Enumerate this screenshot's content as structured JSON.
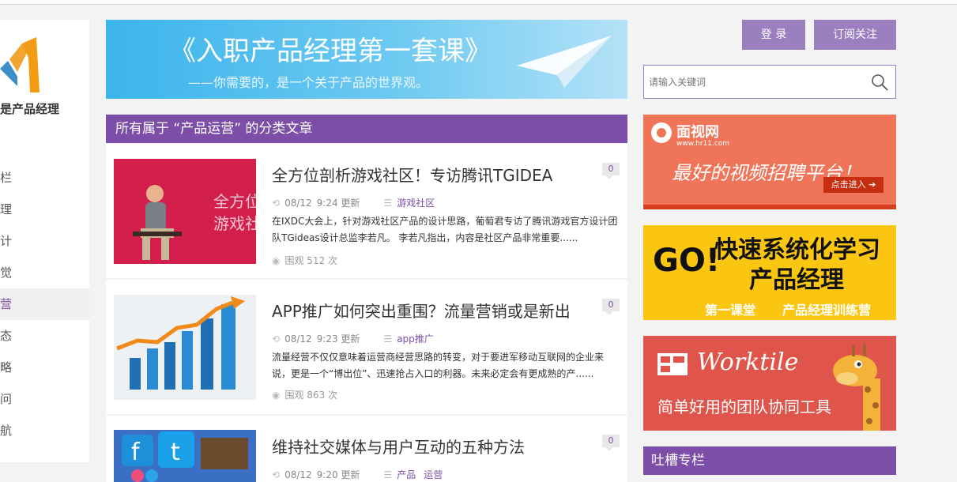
{
  "sidebar": {
    "site_name": "是产品经理",
    "items": [
      {
        "label": "栏"
      },
      {
        "label": "理"
      },
      {
        "label": "计"
      },
      {
        "label": "觉"
      },
      {
        "label": "营"
      },
      {
        "label": "态"
      },
      {
        "label": "略"
      },
      {
        "label": "问"
      },
      {
        "label": "航"
      }
    ]
  },
  "banner": {
    "title": "《入职产品经理第一套课》",
    "subtitle": "——你需要的，是一个关于产品的世界观。"
  },
  "category": {
    "header": "所有属于 “产品运营” 的分类文章"
  },
  "articles": [
    {
      "title": "全方位剖析游戏社区！专访腾讯TGIDEA",
      "comments": "0",
      "date": "08/12",
      "time": "9:24 更新",
      "tags": [
        "游戏社区"
      ],
      "excerpt": "在IXDC大会上，针对游戏社区产品的设计思路，葡萄君专访了腾讯游戏官方设计团队TGideas设计总监李若凡。 李若凡指出，内容是社区产品非常重要......",
      "views": "围观 512 次",
      "thumb_text": "全方位\n游戏社"
    },
    {
      "title": "APP推广如何突出重围？流量营销或是新出",
      "comments": "0",
      "date": "08/12",
      "time": "9:23 更新",
      "tags": [
        "app推广"
      ],
      "excerpt": "流量经营不仅仅意味着运营商经营思路的转变，对于要进军移动互联网的企业来说，更是一个“博出位”、迅速抢占入口的利器。未来必定会有更成熟的产......",
      "views": "围观 863 次"
    },
    {
      "title": "维持社交媒体与用户互动的五种方法",
      "comments": "0",
      "date": "08/12",
      "time": "9:20 更新",
      "tags": [
        "产品",
        "运营"
      ]
    }
  ],
  "header_buttons": {
    "login": "登 录",
    "subscribe": "订阅关注"
  },
  "search": {
    "placeholder": "请输入关键词"
  },
  "ads": {
    "ad1": {
      "brand": "面视网",
      "url": "www.hr11.com",
      "slogan": "最好的视频招聘平台！",
      "cta": "点击进入"
    },
    "ad2": {
      "go": "GO!",
      "line1": "快速系统化学习",
      "line2": "产品经理",
      "brand": "第一课堂",
      "sub": "产品经理训练营"
    },
    "ad3": {
      "brand": "Worktile",
      "slogan": "简单好用的团队协同工具"
    }
  },
  "right_column": {
    "header": "吐槽专栏"
  },
  "colors": {
    "accent": "#7c4ea8",
    "button": "#9b7fbf",
    "banner": "#3bb4ec"
  }
}
